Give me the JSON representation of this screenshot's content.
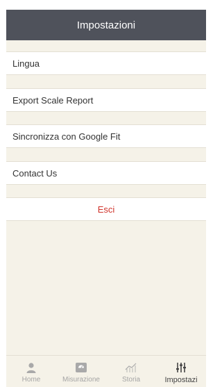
{
  "header": {
    "title": "Impostazioni"
  },
  "settings": {
    "items": [
      {
        "label": "Lingua"
      },
      {
        "label": "Export Scale Report"
      },
      {
        "label": "Sincronizza con Google Fit"
      },
      {
        "label": "Contact Us"
      }
    ],
    "logout_label": "Esci"
  },
  "tabbar": {
    "tabs": [
      {
        "label": "Home",
        "icon": "person-icon"
      },
      {
        "label": "Misurazione",
        "icon": "scale-icon"
      },
      {
        "label": "Storia",
        "icon": "trend-chart-icon"
      },
      {
        "label": "Impostazi",
        "icon": "sliders-icon",
        "active": true
      }
    ]
  },
  "colors": {
    "header_bg": "#4f525b",
    "page_bg": "#f5f2e8",
    "logout_red": "#d0342c"
  }
}
